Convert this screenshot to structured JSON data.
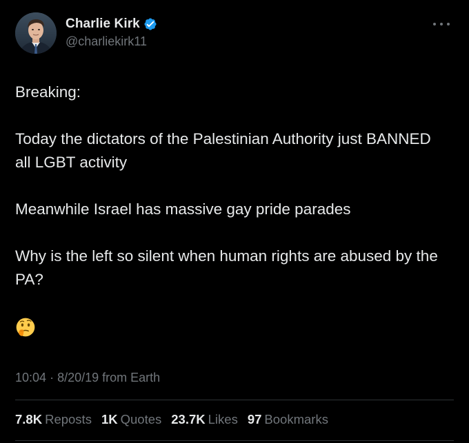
{
  "author": {
    "name": "Charlie Kirk",
    "handle": "@charliekirk11",
    "verified_icon": "verified-badge-icon",
    "avatar_icon": "profile-photo"
  },
  "more_icon": "more-options-icon",
  "tweet": {
    "paragraphs": [
      "Breaking:",
      "Today the dictators of the Palestinian Authority just BANNED all LGBT activity",
      "Meanwhile Israel has massive gay pride parades",
      "Why is the left so silent when human rights are abused by the PA?"
    ],
    "emoji": "🤔"
  },
  "meta": {
    "time": "10:04",
    "separator": "·",
    "date": "8/20/19",
    "source": "from Earth"
  },
  "stats": [
    {
      "count": "7.8K",
      "label": "Reposts"
    },
    {
      "count": "1K",
      "label": "Quotes"
    },
    {
      "count": "23.7K",
      "label": "Likes"
    },
    {
      "count": "97",
      "label": "Bookmarks"
    }
  ],
  "colors": {
    "background": "#000000",
    "text": "#e7e9ea",
    "secondary": "#71767b",
    "verified": "#1d9bf0",
    "divider": "#2f3336"
  }
}
